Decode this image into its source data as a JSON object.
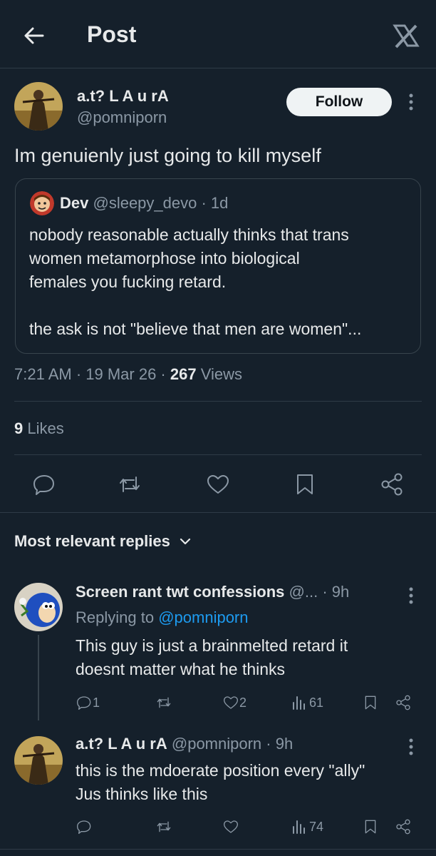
{
  "header": {
    "title": "Post",
    "back_icon": "arrow-left-icon",
    "logo_icon": "x-logo-icon"
  },
  "post": {
    "author_name": "a.t? L A u rA",
    "author_handle": "@pomniporn",
    "follow_label": "Follow",
    "text": "Im genuienly just going to kill myself",
    "quote": {
      "name": "Dev",
      "handle": "@sleepy_devo",
      "time": "· 1d",
      "line1": "nobody reasonable actually thinks that trans",
      "line2": "women metamorphose into biological",
      "line3": "females you fucking retard.",
      "line4": "the ask is not \"believe that men are women\"..."
    },
    "timestamp": "7:21 AM · 19 Mar 26 ·",
    "views_count": "267",
    "views_label": "Views",
    "likes_count": "9",
    "likes_label": "Likes"
  },
  "replies_header": {
    "label": "Most relevant replies"
  },
  "replies": [
    {
      "name": "Screen rant twt confessions",
      "handle_time": "@... · 9h",
      "replying_prefix": "Replying to",
      "replying_handle": "@pomniporn",
      "line1": "This guy is just a brainmelted retard it",
      "line2": "doesnt matter what he thinks",
      "reply_count": "1",
      "like_count": "2",
      "view_count": "61"
    },
    {
      "name": "a.t? L A u rA",
      "handle_time": "@pomniporn · 9h",
      "line1": "this is the mdoerate position every \"ally\"",
      "line2": "Jus thinks like  this",
      "view_count": "74"
    }
  ],
  "colors": {
    "background": "#15202b",
    "text": "#e7e9ea",
    "muted": "#8b98a5",
    "link": "#1d9bf0",
    "border": "#2f3b47"
  }
}
